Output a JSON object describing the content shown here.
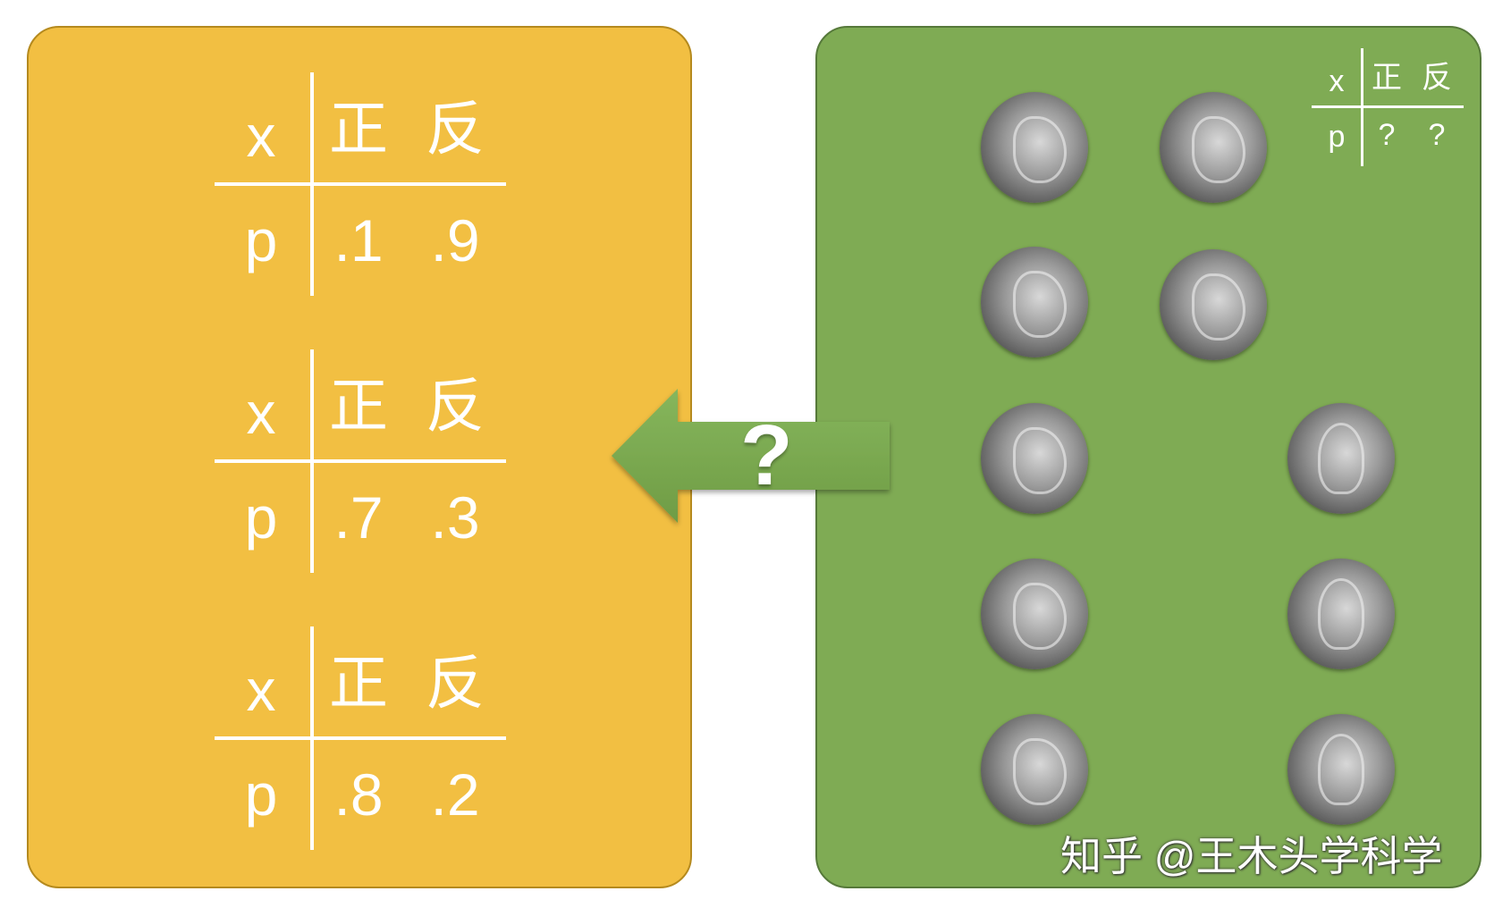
{
  "known_tables": [
    {
      "x_label": "x",
      "heads": "正",
      "tails": "反",
      "p_label": "p",
      "p_heads": ".1",
      "p_tails": ".9"
    },
    {
      "x_label": "x",
      "heads": "正",
      "tails": "反",
      "p_label": "p",
      "p_heads": ".7",
      "p_tails": ".3"
    },
    {
      "x_label": "x",
      "heads": "正",
      "tails": "反",
      "p_label": "p",
      "p_heads": ".8",
      "p_tails": ".2"
    }
  ],
  "unknown_table": {
    "x_label": "x",
    "heads": "正",
    "tails": "反",
    "p_label": "p",
    "p_heads": "?",
    "p_tails": "?"
  },
  "arrow": {
    "label": "?",
    "color": "#7fab54"
  },
  "coins": {
    "heads_count": 7,
    "tails_count": 3
  },
  "watermark": "知乎 @王木头学科学",
  "colors": {
    "yellow": "#f2bf42",
    "green": "#7fab54"
  }
}
